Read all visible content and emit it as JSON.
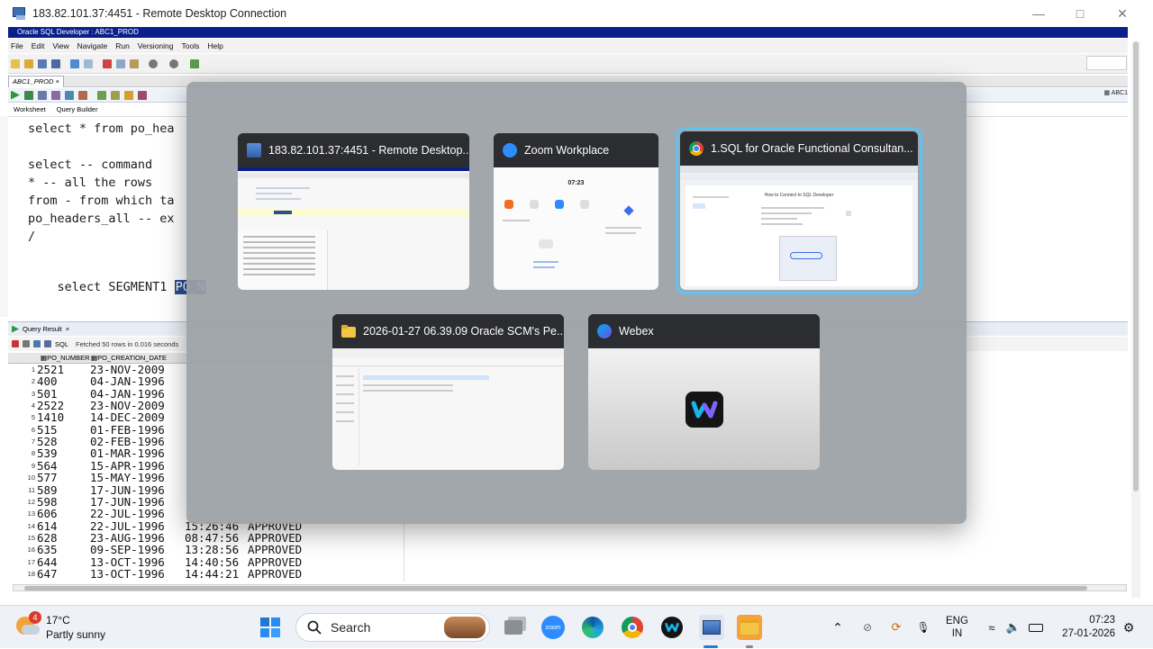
{
  "rd_window": {
    "title": "183.82.101.37:4451 - Remote Desktop Connection"
  },
  "sqldev": {
    "title": "Oracle SQL Developer : ABC1_PROD",
    "menu": [
      "File",
      "Edit",
      "View",
      "Navigate",
      "Run",
      "Versioning",
      "Tools",
      "Help"
    ],
    "connection_tab": "ABC1_PROD",
    "connection_right": "ABC1",
    "subtabs": [
      "Worksheet",
      "Query Builder"
    ],
    "code_lines": {
      "l1": "select * from po_hea",
      "l2": "select -- command",
      "l3": "* -- all the rows",
      "l4": "from - from which ta",
      "l5": "po_headers_all -- ex",
      "l6": "/",
      "l7": "select SEGMENT1 ",
      "l7_selected": "PO_N"
    },
    "query_result": {
      "tab_label": "Query Result",
      "sql_label": "SQL",
      "status": "Fetched 50 rows in 0.016 seconds",
      "columns": [
        "PO_NUMBER",
        "PO_CREATION_DATE"
      ],
      "rows": [
        {
          "n": "1",
          "po": "2521",
          "date": "23-NOV-2009",
          "time": "",
          "status": ""
        },
        {
          "n": "2",
          "po": "400",
          "date": "04-JAN-1996",
          "time": "",
          "status": ""
        },
        {
          "n": "3",
          "po": "501",
          "date": "04-JAN-1996",
          "time": "",
          "status": ""
        },
        {
          "n": "4",
          "po": "2522",
          "date": "23-NOV-2009",
          "time": "",
          "status": ""
        },
        {
          "n": "5",
          "po": "1410",
          "date": "14-DEC-2009",
          "time": "",
          "status": ""
        },
        {
          "n": "6",
          "po": "515",
          "date": "01-FEB-1996",
          "time": "",
          "status": ""
        },
        {
          "n": "7",
          "po": "528",
          "date": "02-FEB-1996",
          "time": "",
          "status": ""
        },
        {
          "n": "8",
          "po": "539",
          "date": "01-MAR-1996",
          "time": "",
          "status": ""
        },
        {
          "n": "9",
          "po": "564",
          "date": "15-APR-1996",
          "time": "",
          "status": ""
        },
        {
          "n": "10",
          "po": "577",
          "date": "15-MAY-1996",
          "time": "",
          "status": ""
        },
        {
          "n": "11",
          "po": "589",
          "date": "17-JUN-1996",
          "time": "",
          "status": ""
        },
        {
          "n": "12",
          "po": "598",
          "date": "17-JUN-1996",
          "time": "",
          "status": ""
        },
        {
          "n": "13",
          "po": "606",
          "date": "22-JUL-1996",
          "time": "",
          "status": ""
        },
        {
          "n": "14",
          "po": "614",
          "date": "22-JUL-1996",
          "time": "15:26:46",
          "status": "APPROVED"
        },
        {
          "n": "15",
          "po": "628",
          "date": "23-AUG-1996",
          "time": "08:47:56",
          "status": "APPROVED"
        },
        {
          "n": "16",
          "po": "635",
          "date": "09-SEP-1996",
          "time": "13:28:56",
          "status": "APPROVED"
        },
        {
          "n": "17",
          "po": "644",
          "date": "13-OCT-1996",
          "time": "14:40:56",
          "status": "APPROVED"
        },
        {
          "n": "18",
          "po": "647",
          "date": "13-OCT-1996",
          "time": "14:44:21",
          "status": "APPROVED"
        }
      ]
    }
  },
  "switcher": {
    "cards": [
      {
        "title": "183.82.101.37:4451 - Remote Desktop...",
        "icon": "remote-desktop-icon"
      },
      {
        "title": "Zoom Workplace",
        "icon": "zoom-icon",
        "preview_time": "07:23"
      },
      {
        "title": "1.SQL for Oracle Functional Consultan...",
        "icon": "chrome-icon",
        "preview_heading": "How to Connect to SQL Developer"
      },
      {
        "title": "2026-01-27 06.39.09 Oracle SCM's Pe...",
        "icon": "folder-icon"
      },
      {
        "title": "Webex",
        "icon": "webex-icon"
      }
    ]
  },
  "taskbar": {
    "weather_temp": "17°C",
    "weather_desc": "Partly sunny",
    "weather_badge": "4",
    "search_label": "Search",
    "lang_1": "ENG",
    "lang_2": "IN",
    "time": "07:23",
    "date": "27-01-2026"
  },
  "colors": {
    "selection": "#5ec3f0",
    "sqldev_title": "#0b1f8a",
    "keyword": "#1a34b5"
  }
}
